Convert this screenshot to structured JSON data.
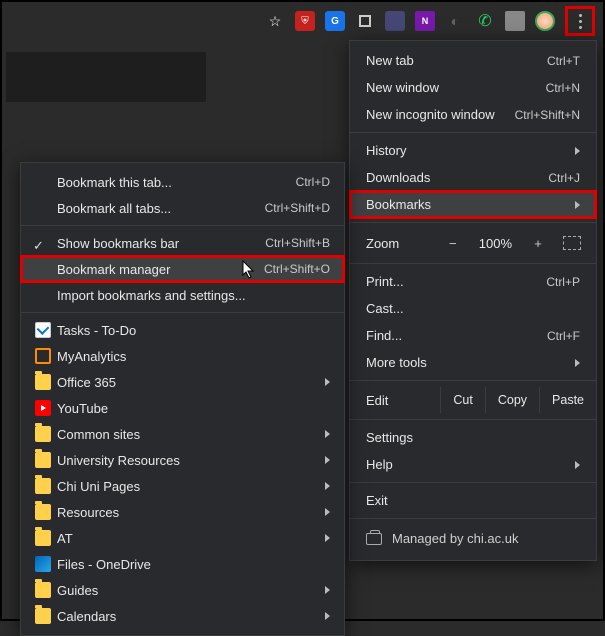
{
  "toolbar": {
    "icons": [
      "star",
      "shield",
      "translate",
      "box",
      "teams",
      "onenote",
      "dim",
      "whatsapp",
      "calendar",
      "avatar"
    ]
  },
  "main_menu": {
    "items_top": [
      {
        "label": "New tab",
        "shortcut": "Ctrl+T"
      },
      {
        "label": "New window",
        "shortcut": "Ctrl+N"
      },
      {
        "label": "New incognito window",
        "shortcut": "Ctrl+Shift+N"
      }
    ],
    "history": {
      "label": "History"
    },
    "downloads": {
      "label": "Downloads",
      "shortcut": "Ctrl+J"
    },
    "bookmarks": {
      "label": "Bookmarks"
    },
    "zoom": {
      "label": "Zoom",
      "value": "100%"
    },
    "print": {
      "label": "Print...",
      "shortcut": "Ctrl+P"
    },
    "cast": {
      "label": "Cast..."
    },
    "find": {
      "label": "Find...",
      "shortcut": "Ctrl+F"
    },
    "moretools": {
      "label": "More tools"
    },
    "edit": {
      "label": "Edit",
      "cut": "Cut",
      "copy": "Copy",
      "paste": "Paste"
    },
    "settings": {
      "label": "Settings"
    },
    "help": {
      "label": "Help"
    },
    "exit": {
      "label": "Exit"
    },
    "managed": {
      "label": "Managed by chi.ac.uk"
    }
  },
  "sub_menu": {
    "bookmark_tab": {
      "label": "Bookmark this tab...",
      "shortcut": "Ctrl+D"
    },
    "bookmark_all": {
      "label": "Bookmark all tabs...",
      "shortcut": "Ctrl+Shift+D"
    },
    "show_bar": {
      "label": "Show bookmarks bar",
      "shortcut": "Ctrl+Shift+B"
    },
    "manager": {
      "label": "Bookmark manager",
      "shortcut": "Ctrl+Shift+O"
    },
    "import": {
      "label": "Import bookmarks and settings..."
    },
    "folders": [
      {
        "label": "Tasks - To-Do",
        "icon": "tasks"
      },
      {
        "label": "MyAnalytics",
        "icon": "myan"
      },
      {
        "label": "Office 365",
        "icon": "folder",
        "sub": true
      },
      {
        "label": "YouTube",
        "icon": "yt"
      },
      {
        "label": "Common sites",
        "icon": "folder",
        "sub": true
      },
      {
        "label": "University Resources",
        "icon": "folder",
        "sub": true
      },
      {
        "label": "Chi Uni Pages",
        "icon": "folder",
        "sub": true
      },
      {
        "label": "Resources",
        "icon": "folder",
        "sub": true
      },
      {
        "label": "AT",
        "icon": "folder",
        "sub": true
      },
      {
        "label": "Files - OneDrive",
        "icon": "od"
      },
      {
        "label": "Guides",
        "icon": "folder",
        "sub": true
      },
      {
        "label": "Calendars",
        "icon": "folder",
        "sub": true
      }
    ]
  }
}
